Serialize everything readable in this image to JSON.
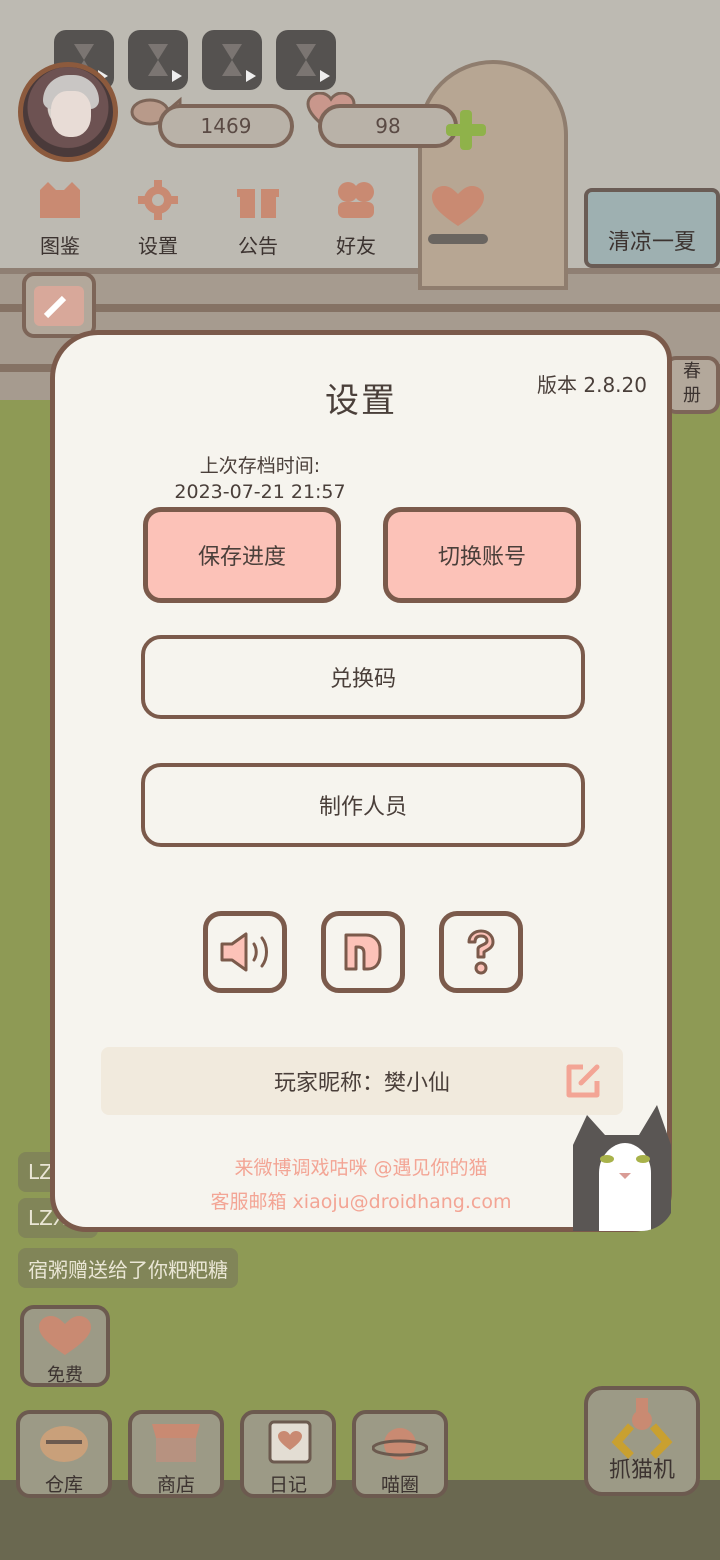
{
  "topbar": {
    "coins": "1469",
    "hearts": "98"
  },
  "nav": [
    {
      "label": "图鉴"
    },
    {
      "label": "设置"
    },
    {
      "label": "公告"
    },
    {
      "label": "好友"
    }
  ],
  "event_banner": {
    "label": "清凉一夏"
  },
  "side_partial": {
    "label_top": "春",
    "label_bottom": "册"
  },
  "chat": [
    {
      "text": "LZ"
    },
    {
      "text": "LZX"
    },
    {
      "text": "宿粥赠送给了你粑粑糖"
    }
  ],
  "free_button": {
    "label": "免费"
  },
  "bottom_tabs": [
    {
      "label": "仓库"
    },
    {
      "label": "商店"
    },
    {
      "label": "日记"
    },
    {
      "label": "喵圈"
    }
  ],
  "claw_button": {
    "label": "抓猫机"
  },
  "dialog": {
    "title": "设置",
    "version": "版本 2.8.20",
    "last_save_label": "上次存档时间:",
    "last_save_time": "2023-07-21 21:57",
    "save_button": "保存进度",
    "switch_account_button": "切换账号",
    "redeem_code_button": "兑换码",
    "credits_button": "制作人员",
    "icons": [
      "speaker-icon",
      "music-note-icon",
      "help-question-icon"
    ],
    "nickname": "玩家昵称：樊小仙",
    "weibo_line": "来微博调戏咕咪 @遇见你的猫",
    "email_line": "客服邮箱 xiaoju@droidhang.com"
  },
  "colors": {
    "pink_button": "#fcc2b8",
    "border_brown": "#7b5a4b",
    "dialog_bg": "#f6f4ee",
    "footer_text": "#f3a595"
  }
}
